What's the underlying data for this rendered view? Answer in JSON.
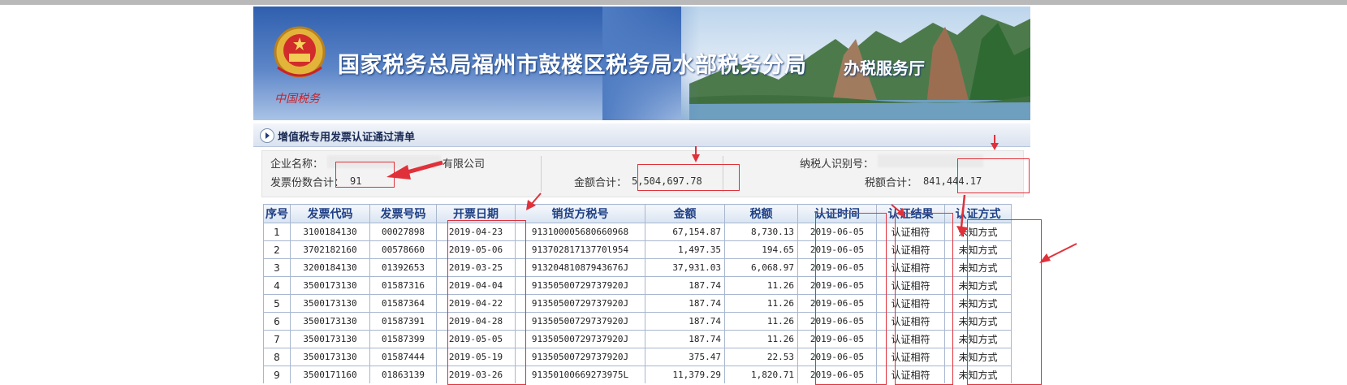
{
  "banner": {
    "title": "国家税务总局福州市鼓楼区税务局水部税务分局",
    "subtitle": "办税服务厅",
    "emblem_text": "中国税务"
  },
  "section": {
    "title": "增值税专用发票认证通过清单"
  },
  "info": {
    "company_label": "企业名称：",
    "company_value_tail": "有限公司",
    "invoice_count_label": "发票份数合计：",
    "invoice_count_value": "91",
    "amount_total_label": "金额合计：",
    "amount_total_value": "5,504,697.78",
    "taxpayer_id_label": "纳税人识别号：",
    "tax_total_label": "税额合计：",
    "tax_total_value": "841,444.17"
  },
  "table": {
    "headers": [
      "序号",
      "发票代码",
      "发票号码",
      "开票日期",
      "销货方税号",
      "金额",
      "税额",
      "认证时间",
      "认证结果",
      "认证方式"
    ],
    "rows": [
      [
        "1",
        "3100184130",
        "00027898",
        "2019-04-23",
        "913100005680660968",
        "67,154.87",
        "8,730.13",
        "2019-06-05",
        "认证相符",
        "未知方式"
      ],
      [
        "2",
        "3702182160",
        "00578660",
        "2019-05-06",
        "91370281713770l954",
        "1,497.35",
        "194.65",
        "2019-06-05",
        "认证相符",
        "未知方式"
      ],
      [
        "3",
        "3200184130",
        "01392653",
        "2019-03-25",
        "91320481087943676J",
        "37,931.03",
        "6,068.97",
        "2019-06-05",
        "认证相符",
        "未知方式"
      ],
      [
        "4",
        "3500173130",
        "01587316",
        "2019-04-04",
        "91350500729737920J",
        "187.74",
        "11.26",
        "2019-06-05",
        "认证相符",
        "未知方式"
      ],
      [
        "5",
        "3500173130",
        "01587364",
        "2019-04-22",
        "91350500729737920J",
        "187.74",
        "11.26",
        "2019-06-05",
        "认证相符",
        "未知方式"
      ],
      [
        "6",
        "3500173130",
        "01587391",
        "2019-04-28",
        "91350500729737920J",
        "187.74",
        "11.26",
        "2019-06-05",
        "认证相符",
        "未知方式"
      ],
      [
        "7",
        "3500173130",
        "01587399",
        "2019-05-05",
        "91350500729737920J",
        "187.74",
        "11.26",
        "2019-06-05",
        "认证相符",
        "未知方式"
      ],
      [
        "8",
        "3500173130",
        "01587444",
        "2019-05-19",
        "91350500729737920J",
        "375.47",
        "22.53",
        "2019-06-05",
        "认证相符",
        "未知方式"
      ],
      [
        "9",
        "3500171160",
        "01863139",
        "2019-03-26",
        "91350100669273975L",
        "11,379.29",
        "1,820.71",
        "2019-06-05",
        "认证相符",
        "未知方式"
      ]
    ]
  },
  "colors": {
    "annotation": "#e0313a",
    "header_text": "#1e3f85",
    "banner": "#2f5fae"
  }
}
